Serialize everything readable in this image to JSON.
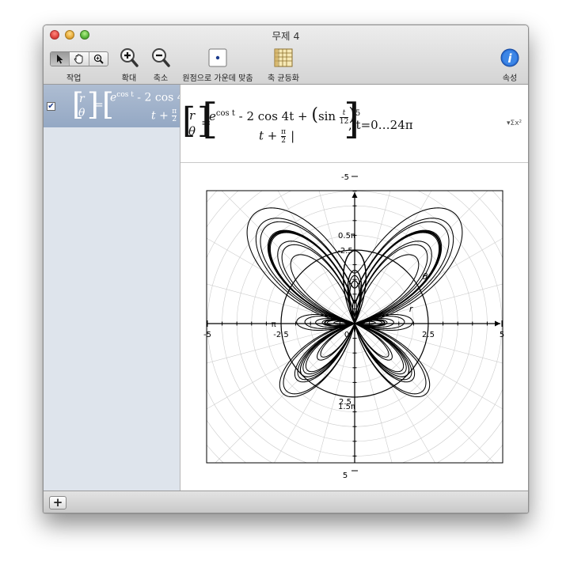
{
  "window": {
    "title": "무제 4"
  },
  "toolbar": {
    "task_label": "작업",
    "zoom_in_label": "확대",
    "zoom_out_label": "축소",
    "center_label": "원점으로 가운데 맞춤",
    "equalize_label": "축 균등화",
    "properties_label": "속성"
  },
  "sidebar": {
    "items": [
      {
        "checked": true,
        "checkbox": "✔",
        "preview_lhs_top": "r",
        "preview_lhs_bottom": "θ",
        "preview_top": "e",
        "preview_top_sup": "cos t",
        "preview_top_rest": " - 2 cos 4t +",
        "preview_bottom": "t + ",
        "preview_bottom_num": "π",
        "preview_bottom_den": "2"
      }
    ]
  },
  "equation": {
    "lhs_top": "r",
    "lhs_bottom": "θ",
    "top_base": "e",
    "top_sup": "cos t",
    "top_mid": " - 2 cos 4t + ",
    "top_paren_open": "(",
    "top_sin": "sin ",
    "top_frac_num": "t",
    "top_frac_den": "12",
    "top_paren_close": ")",
    "top_power": "5",
    "bottom_t": "t + ",
    "bottom_frac_num": "π",
    "bottom_frac_den": "2",
    "cursor": "|",
    "range": ", t=0…24π",
    "sigma_button": "▾Σx²"
  },
  "graph": {
    "x_tick_labels": [
      "-5",
      "-2.5",
      "0",
      "2.5",
      "5"
    ],
    "y_tick_labels": [
      "5",
      "2.5",
      "-2.5",
      "-5"
    ],
    "polar_labels": {
      "half_pi": "0.5π",
      "one_half_pi": "1.5π",
      "pi": "π"
    },
    "curve_labels": {
      "theta": "θ",
      "r": "r"
    },
    "colors": {
      "grid": "#cccccc",
      "curve": "#000000",
      "frame": "#000000"
    }
  },
  "chart_data": {
    "type": "line",
    "title": "",
    "polar": true,
    "equation": "r = e^(cos t) - 2 cos 4t + (sin t/12)^5, θ = t + π/2, t = 0…24π",
    "xlim": [
      -5,
      5
    ],
    "ylim": [
      -5,
      5
    ],
    "x_ticks": [
      -5,
      -2.5,
      0,
      2.5,
      5
    ],
    "y_ticks": [
      -5,
      -2.5,
      2.5,
      5
    ],
    "grid": true
  },
  "bottom": {
    "add_label": "+"
  }
}
